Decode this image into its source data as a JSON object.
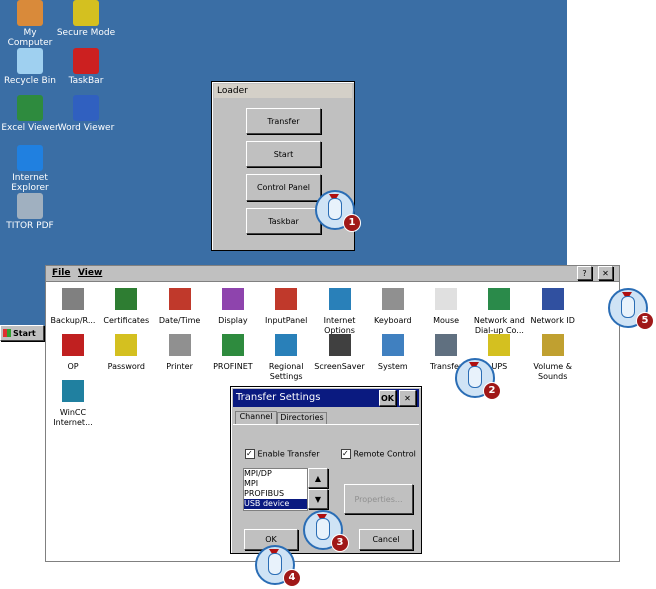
{
  "desktop": {
    "icons": [
      {
        "label": "My Computer",
        "color": "#d98a3a"
      },
      {
        "label": "Secure Mode",
        "color": "#d4c020"
      },
      {
        "label": "Recycle Bin",
        "color": "#9fd0f0"
      },
      {
        "label": "TaskBar",
        "color": "#cc2020"
      },
      {
        "label": "Excel Viewer",
        "color": "#2e8b3e"
      },
      {
        "label": "Word Viewer",
        "color": "#3060c0"
      },
      {
        "label": "Internet Explorer",
        "color": "#2080e0"
      },
      {
        "label": "TITOR PDF",
        "color": "#a0b0c0"
      }
    ]
  },
  "start": {
    "label": "Start"
  },
  "loader": {
    "title": "Loader",
    "buttons": [
      "Transfer",
      "Start",
      "Control Panel",
      "Taskbar"
    ]
  },
  "control_panel": {
    "menu": [
      "File",
      "View"
    ],
    "help": "?",
    "close": "✕",
    "items": [
      {
        "label": "Backup/R...",
        "color": "#808080"
      },
      {
        "label": "Certificates",
        "color": "#2e7d32"
      },
      {
        "label": "Date/Time",
        "color": "#c0392b"
      },
      {
        "label": "Display",
        "color": "#8e44ad"
      },
      {
        "label": "InputPanel",
        "color": "#c0392b"
      },
      {
        "label": "Internet Options",
        "color": "#2980b9"
      },
      {
        "label": "Keyboard",
        "color": "#909090"
      },
      {
        "label": "Mouse",
        "color": "#e0e0e0"
      },
      {
        "label": "Network and Dial-up Co...",
        "color": "#2a8a4a"
      },
      {
        "label": "Network ID",
        "color": "#3050a0"
      },
      {
        "label": "OP",
        "color": "#c02020"
      },
      {
        "label": "Password",
        "color": "#d4c020"
      },
      {
        "label": "Printer",
        "color": "#909090"
      },
      {
        "label": "PROFINET",
        "color": "#2e8b3e"
      },
      {
        "label": "Regional Settings",
        "color": "#2980b9"
      },
      {
        "label": "ScreenSaver",
        "color": "#404040"
      },
      {
        "label": "System",
        "color": "#4080c0"
      },
      {
        "label": "Transfer",
        "color": "#607080"
      },
      {
        "label": "UPS",
        "color": "#d4c020"
      },
      {
        "label": "Volume & Sounds",
        "color": "#c0a030"
      },
      {
        "label": "WinCC Internet...",
        "color": "#2080a0"
      }
    ]
  },
  "transfer": {
    "title": "Transfer Settings",
    "ok_title": "OK",
    "close": "✕",
    "tabs": [
      "Channel",
      "Directories"
    ],
    "enable_transfer": {
      "label": "Enable Transfer",
      "checked": true
    },
    "remote_control": {
      "label": "Remote Control",
      "checked": true
    },
    "channels": [
      "MPI/DP",
      "MPI",
      "PROFIBUS",
      "USB device"
    ],
    "selected": "USB device",
    "properties": "Properties...",
    "ok": "OK",
    "cancel": "Cancel"
  },
  "callouts": [
    "1",
    "2",
    "3",
    "4",
    "5"
  ]
}
